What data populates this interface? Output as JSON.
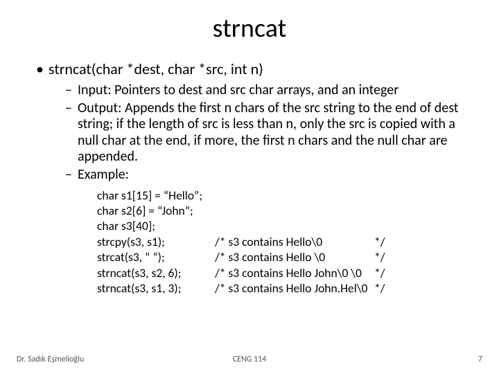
{
  "title": "strncat",
  "signature": "strncat(char *dest, char *src, int n)",
  "indent": {
    "input": "Input:  Pointers to dest and src char arrays, and an integer",
    "output": "Output:  Appends the first n chars of the src string to the end of dest string; if the length of src is less than n, only the src is copied with a null char at the end, if more, the first n chars and the null char are appended.",
    "example": "Example:"
  },
  "code": {
    "l1": "char        s1[15] = “Hello”;",
    "l2": "char        s2[6] = “John”;",
    "l3": "char        s3[40];",
    "l4a": "strcpy(s3, s1);",
    "l4b": "/* s3 contains  Hello\\0",
    "l4c": "*/",
    "l5a": "strcat(s3, “ “);",
    "l5b": "/* s3 contains  Hello \\0",
    "l5c": "*/",
    "l6a": "strncat(s3, s2, 6);",
    "l6b": "/* s3 contains  Hello John\\0 \\0",
    "l6c": "*/",
    "l7a": "strncat(s3, s1, 3);",
    "l7b": "/* s3 contains  Hello John.Hel\\0",
    "l7c": "*/"
  },
  "footer": {
    "left": "Dr. Sadık Eşmelioğlu",
    "center": "CENG 114",
    "right": "7"
  }
}
